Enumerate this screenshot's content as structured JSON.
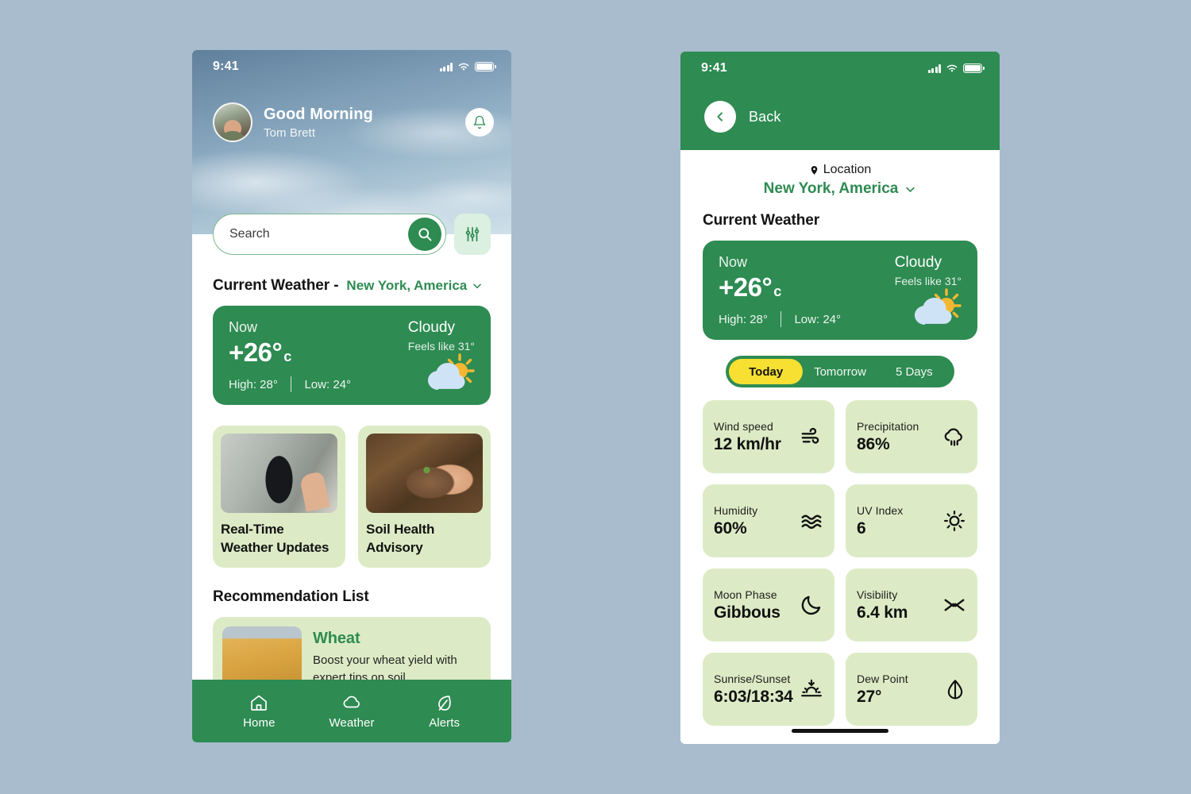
{
  "home": {
    "status": {
      "time": "9:41",
      "signal_icon": "signal-bars-icon",
      "wifi_icon": "wifi-icon",
      "battery_icon": "battery-icon"
    },
    "header": {
      "greeting": "Good Morning",
      "user_name": "Tom Brett",
      "avatar_icon": "user-avatar",
      "bell_icon": "notification-bell-icon"
    },
    "search": {
      "placeholder": "Search",
      "value": "",
      "search_icon": "search-icon",
      "filter_icon": "filter-sliders-icon"
    },
    "current_weather": {
      "title": "Current Weather -",
      "location": "New York, America",
      "chevron_icon": "chevron-down-icon",
      "now_label": "Now",
      "condition": "Cloudy",
      "temperature": "+26°",
      "unit": "c",
      "feels_like": "Feels like 31°",
      "high": "High: 28°",
      "low": "Low: 24°",
      "weather_icon": "sun-behind-cloud-icon"
    },
    "features": [
      {
        "title": "Real-Time Weather Updates",
        "image_icon": "phone-weather-app-photo"
      },
      {
        "title": "Soil Health Advisory",
        "image_icon": "hand-holding-soil-photo"
      }
    ],
    "recommendation": {
      "section_title": "Recommendation List",
      "items": [
        {
          "name": "Wheat",
          "description": "Boost your wheat yield with expert tips on soil management, irrigation timing, pest control,",
          "image_icon": "wheat-field-photo"
        }
      ]
    },
    "bottom_nav": [
      {
        "label": "Home",
        "icon": "home-icon"
      },
      {
        "label": "Weather",
        "icon": "cloud-icon"
      },
      {
        "label": "Alerts",
        "icon": "leaf-icon"
      }
    ]
  },
  "detail": {
    "status": {
      "time": "9:41",
      "signal_icon": "signal-bars-icon",
      "wifi_icon": "wifi-icon",
      "battery_icon": "battery-icon"
    },
    "back_label": "Back",
    "back_icon": "chevron-left-icon",
    "location": {
      "label": "Location",
      "pin_icon": "map-pin-icon",
      "city": "New York, America",
      "chevron_icon": "chevron-down-icon"
    },
    "section_title": "Current Weather",
    "current_weather": {
      "now_label": "Now",
      "condition": "Cloudy",
      "temperature": "+26°",
      "unit": "c",
      "feels_like": "Feels like 31°",
      "high": "High: 28°",
      "low": "Low: 24°",
      "weather_icon": "sun-behind-cloud-icon"
    },
    "tabs": [
      {
        "label": "Today",
        "active": true
      },
      {
        "label": "Tomorrow",
        "active": false
      },
      {
        "label": "5 Days",
        "active": false
      }
    ],
    "metrics": [
      {
        "label": "Wind speed",
        "value": "12 km/hr",
        "icon": "wind-icon"
      },
      {
        "label": "Precipitation",
        "value": "86%",
        "icon": "rain-cloud-icon"
      },
      {
        "label": "Humidity",
        "value": "60%",
        "icon": "humidity-waves-icon"
      },
      {
        "label": "UV Index",
        "value": "6",
        "icon": "sun-icon"
      },
      {
        "label": "Moon Phase",
        "value": "Gibbous",
        "icon": "moon-icon"
      },
      {
        "label": "Visibility",
        "value": "6.4 km",
        "icon": "eye-closed-icon"
      },
      {
        "label": "Sunrise/Sunset",
        "value": "6:03/18:34",
        "icon": "sunrise-sunset-icon"
      },
      {
        "label": "Dew Point",
        "value": "27°",
        "icon": "dew-drop-icon"
      }
    ]
  },
  "colors": {
    "brand_green": "#2E8B52",
    "light_green": "#DCEBC5",
    "accent_yellow": "#F7E031",
    "page_background": "#A8BCCD",
    "mint": "#DBF0E0"
  }
}
